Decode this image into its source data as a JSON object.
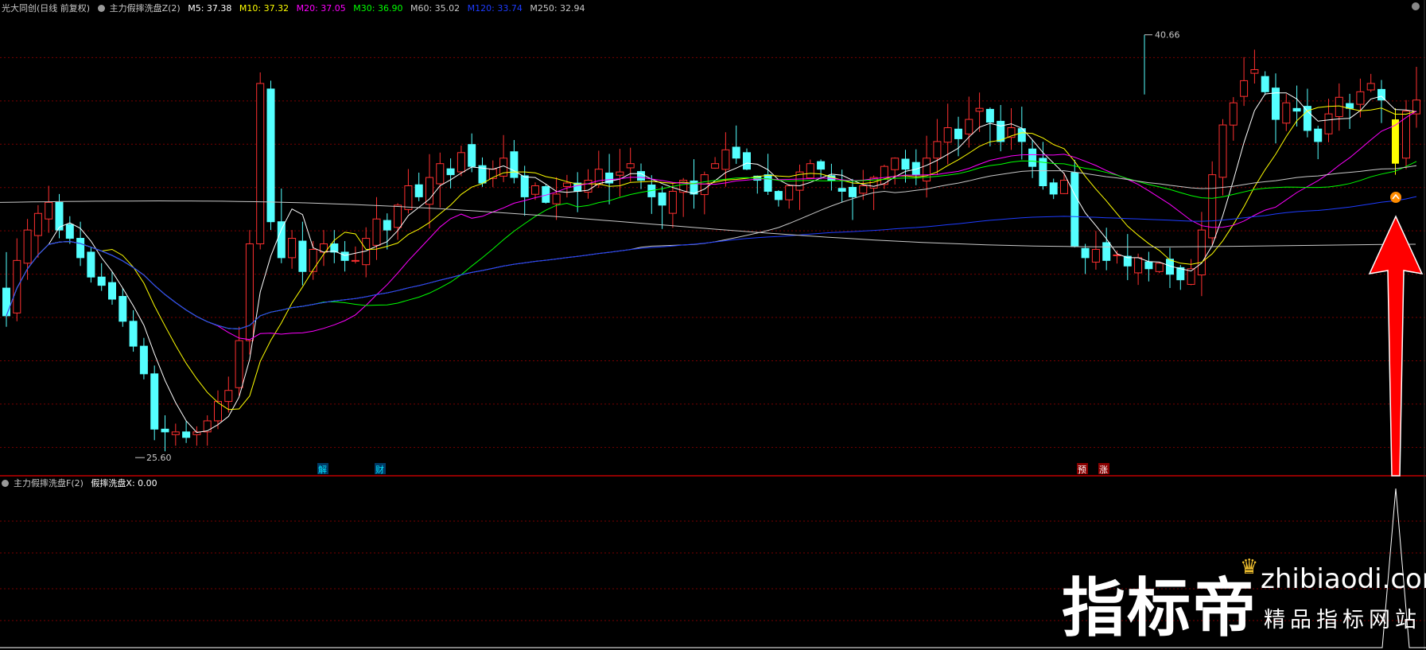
{
  "header": {
    "stock_name": "光大同创(日线 前复权)",
    "indicator_main": "主力假摔洗盘Z(2)",
    "ma_labels": [
      {
        "text": "M5: 37.38",
        "color": "#ffffff"
      },
      {
        "text": "M10: 37.32",
        "color": "#ffff00"
      },
      {
        "text": "M20: 37.05",
        "color": "#ff00ff"
      },
      {
        "text": "M30: 36.90",
        "color": "#00ff00"
      },
      {
        "text": "M60: 35.02",
        "color": "#c8c8c8"
      },
      {
        "text": "M120: 33.74",
        "color": "#1e3cff"
      },
      {
        "text": "M250: 32.94",
        "color": "#c8c8c8"
      }
    ]
  },
  "sub_header": {
    "indicator": "主力假摔洗盘F(2)",
    "value_label": "假摔洗盘X: 0.00"
  },
  "annotations": {
    "high_label": "40.66",
    "low_label": "25.60",
    "event_markers": [
      {
        "text": "解",
        "color": "#00e5ff",
        "bg": "#003a66"
      },
      {
        "text": "财",
        "color": "#00e5ff",
        "bg": "#003a66"
      },
      {
        "text": "预",
        "color": "#ffffff",
        "bg": "#8a0000"
      },
      {
        "text": "涨",
        "color": "#ffffff",
        "bg": "#8a0000"
      }
    ]
  },
  "watermark": {
    "name": "指标帝",
    "domain": "zhibiaodi.com",
    "tagline": "精品指标网站"
  },
  "colors": {
    "up": "#ff3030",
    "down": "#54ffff",
    "signal": "#ffff00",
    "grid": "#7a0000",
    "divider": "#c00000",
    "arrow": "#ff0000"
  },
  "chart_data": {
    "type": "candlestick",
    "ylim": [
      24.8,
      41.4
    ],
    "ohlc": [
      [
        31.5,
        32.8,
        30.1,
        30.5
      ],
      [
        30.6,
        33.3,
        30.3,
        32.5
      ],
      [
        32.4,
        34.0,
        31.8,
        33.6
      ],
      [
        33.4,
        34.5,
        32.6,
        34.2
      ],
      [
        34.0,
        35.2,
        33.5,
        34.6
      ],
      [
        34.6,
        34.9,
        33.3,
        33.6
      ],
      [
        33.8,
        34.1,
        33.1,
        33.3
      ],
      [
        33.3,
        33.9,
        32.3,
        32.6
      ],
      [
        32.8,
        33.0,
        31.7,
        31.9
      ],
      [
        31.9,
        32.4,
        31.4,
        31.6
      ],
      [
        31.7,
        32.1,
        30.9,
        31.1
      ],
      [
        31.2,
        31.5,
        30.1,
        30.3
      ],
      [
        30.3,
        30.7,
        29.2,
        29.4
      ],
      [
        29.4,
        29.7,
        28.2,
        28.4
      ],
      [
        28.4,
        28.7,
        26.0,
        26.4
      ],
      [
        26.4,
        26.9,
        25.6,
        26.3
      ],
      [
        26.2,
        26.6,
        25.8,
        26.3
      ],
      [
        26.3,
        26.7,
        25.9,
        26.1
      ],
      [
        26.2,
        26.5,
        25.8,
        26.3
      ],
      [
        26.3,
        26.9,
        25.8,
        26.7
      ],
      [
        26.7,
        27.8,
        26.4,
        27.4
      ],
      [
        27.4,
        28.3,
        27.0,
        27.8
      ],
      [
        27.9,
        30.1,
        27.6,
        29.6
      ],
      [
        29.6,
        33.6,
        29.1,
        33.1
      ],
      [
        33.1,
        39.3,
        32.9,
        38.9
      ],
      [
        38.7,
        39.0,
        33.6,
        33.9
      ],
      [
        33.9,
        35.1,
        32.4,
        32.6
      ],
      [
        32.6,
        33.6,
        32.2,
        33.3
      ],
      [
        33.2,
        33.9,
        31.6,
        32.1
      ],
      [
        32.1,
        33.2,
        31.8,
        32.9
      ],
      [
        32.8,
        33.6,
        32.3,
        33.1
      ],
      [
        33.1,
        33.6,
        32.4,
        32.8
      ],
      [
        32.8,
        33.2,
        32.1,
        32.5
      ]
    ],
    "candles_note": "visible daily candles; full series continues to the right edge",
    "high": 40.66,
    "low": 25.6
  }
}
